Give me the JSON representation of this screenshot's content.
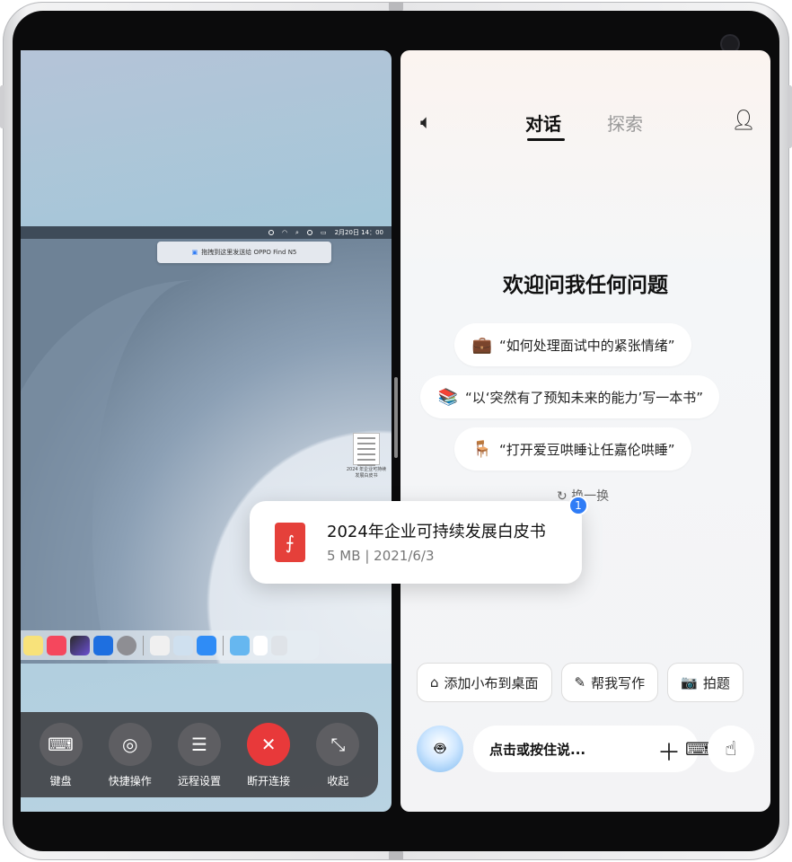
{
  "left": {
    "menubar": {
      "datetime": "2月20日 14：00"
    },
    "drop_tip": "拖拽到这里发送给 OPPO Find N5",
    "desktop_doc_label": "2024 年企业可持续发展白皮书",
    "controls": [
      {
        "label": "键盘",
        "icon": "keyboard-icon",
        "glyph": "⌨"
      },
      {
        "label": "快捷操作",
        "icon": "shortcut-icon",
        "glyph": "◎"
      },
      {
        "label": "远程设置",
        "icon": "sliders-icon",
        "glyph": "☰"
      },
      {
        "label": "断开连接",
        "icon": "unlink-icon",
        "glyph": "✕",
        "color": "#e8393a"
      },
      {
        "label": "收起",
        "icon": "collapse-icon",
        "glyph": "⤡"
      }
    ]
  },
  "right": {
    "tabs": [
      {
        "label": "对话",
        "active": true
      },
      {
        "label": "探索",
        "active": false
      }
    ],
    "welcome": "欢迎问我任何问题",
    "suggestions": [
      {
        "icon": "briefcase-icon",
        "glyph": "💼",
        "text": "“如何处理面试中的紧张情绪”"
      },
      {
        "icon": "books-icon",
        "glyph": "📚",
        "text": "“以‘突然有了预知未来的能力’写一本书”"
      },
      {
        "icon": "chair-icon",
        "glyph": "🪑",
        "text": "“打开爱豆哄睡让任嘉伦哄睡”"
      }
    ],
    "refresh": "换一换",
    "chips": [
      {
        "icon": "home-add-icon",
        "glyph": "⌂",
        "label": "添加小布到桌面"
      },
      {
        "icon": "magic-pen-icon",
        "glyph": "✎",
        "label": "帮我写作"
      },
      {
        "icon": "camera-icon",
        "glyph": "📷",
        "label": "拍题"
      }
    ],
    "input_placeholder": "点击或按住说..."
  },
  "file_card": {
    "title": "2024年企业可持续发展白皮书",
    "size": "5 MB",
    "date": "2021/6/3",
    "badge": "1"
  },
  "colors": {
    "accent_red": "#e8393a",
    "badge_blue": "#2f7cf6"
  }
}
